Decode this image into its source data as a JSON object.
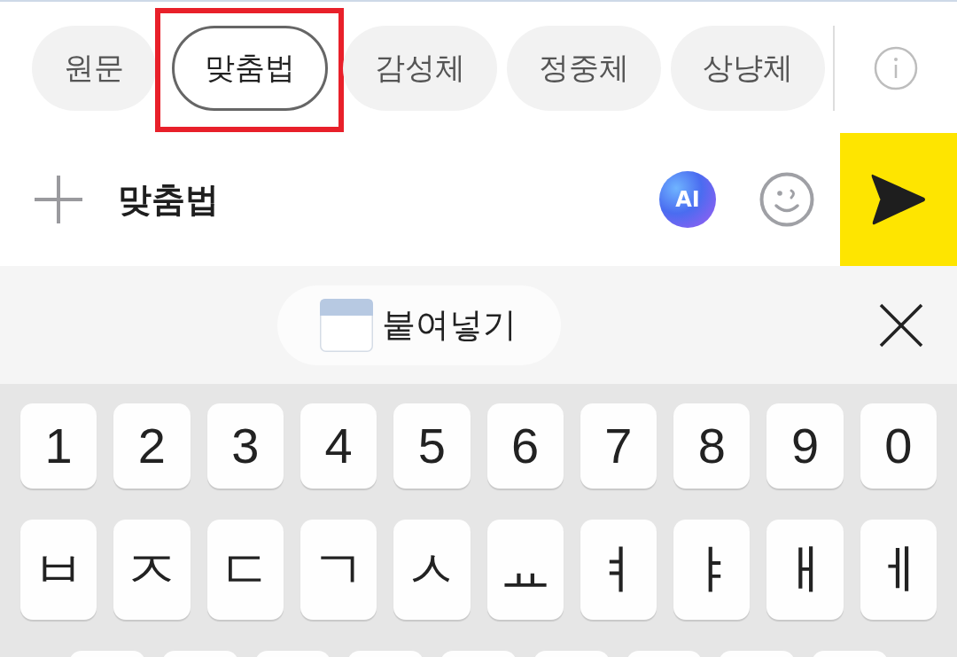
{
  "style_chips": [
    {
      "label": "원문",
      "selected": false,
      "highlighted": false
    },
    {
      "label": "맞춤법",
      "selected": true,
      "highlighted": true
    },
    {
      "label": "감성체",
      "selected": false,
      "highlighted": false
    },
    {
      "label": "정중체",
      "selected": false,
      "highlighted": false
    },
    {
      "label": "상냥체",
      "selected": false,
      "highlighted": false
    }
  ],
  "composer": {
    "value": "맞춤법",
    "ai_button": {
      "label": "AI"
    }
  },
  "clipboard": {
    "paste_label": "붙여넣기"
  },
  "keyboard": {
    "rows": [
      [
        "1",
        "2",
        "3",
        "4",
        "5",
        "6",
        "7",
        "8",
        "9",
        "0"
      ],
      [
        "ㅂ",
        "ㅈ",
        "ㄷ",
        "ㄱ",
        "ㅅ",
        "ㅛ",
        "ㅕ",
        "ㅑ",
        "ㅐ",
        "ㅔ"
      ]
    ]
  }
}
